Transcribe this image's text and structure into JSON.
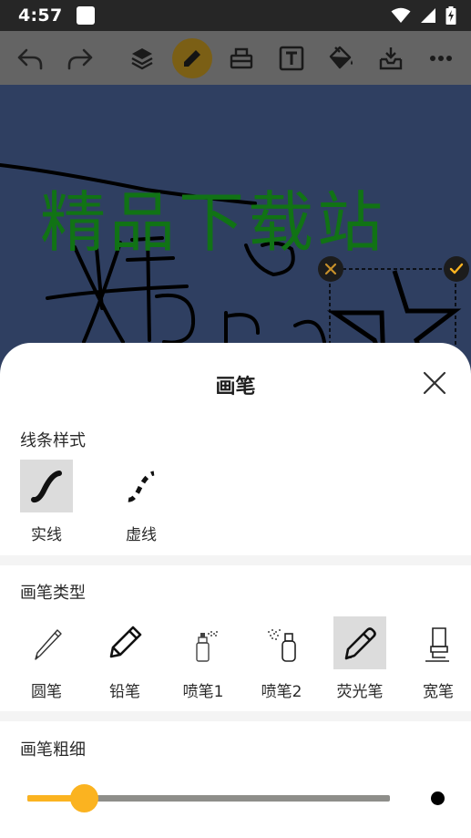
{
  "status_bar": {
    "time": "4:57"
  },
  "canvas": {
    "text": "精品下载站"
  },
  "sheet": {
    "title": "画笔",
    "line_style": {
      "label": "线条样式",
      "options": [
        "实线",
        "虚线"
      ],
      "selected": "实线"
    },
    "brush_type": {
      "label": "画笔类型",
      "options": [
        "圆笔",
        "铅笔",
        "喷笔1",
        "喷笔2",
        "荧光笔",
        "宽笔"
      ],
      "selected": "荧光笔"
    },
    "brush_size": {
      "label": "画笔粗细",
      "value_fraction": 0.155
    }
  },
  "colors": {
    "accent": "#fbb320",
    "active_tool": "#7b5f15",
    "canvas_bg": "#2f3f61",
    "canvas_text": "#117315",
    "toolbar_bg": "#646464"
  },
  "icons": {
    "toolbar": [
      "undo-icon",
      "redo-icon",
      "layers-icon",
      "pen-icon",
      "eraser-icon",
      "text-icon",
      "fill-bucket-icon",
      "inbox-icon",
      "more-icon"
    ],
    "status": [
      "wifi-icon",
      "signal-icon",
      "battery-charging-icon"
    ]
  }
}
